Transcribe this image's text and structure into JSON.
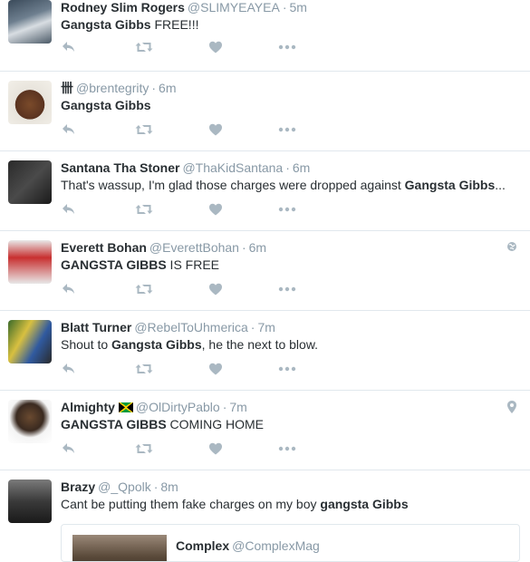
{
  "tweets": [
    {
      "name": "Rodney Slim Rogers",
      "handle": "@SLIMYEAYEA",
      "time": "5m",
      "text": [
        {
          "t": "Gangsta Gibbs",
          "b": true
        },
        {
          "t": " FREE!!!",
          "b": false
        }
      ]
    },
    {
      "name": "卌",
      "handle": "@brentegrity",
      "time": "6m",
      "text": [
        {
          "t": "Gangsta Gibbs",
          "b": true
        }
      ]
    },
    {
      "name": "Santana Tha Stoner",
      "handle": "@ThaKidSantana",
      "time": "6m",
      "text": [
        {
          "t": "That's wassup, I'm glad those charges were dropped against ",
          "b": false
        },
        {
          "t": "Gangsta Gibbs",
          "b": true
        },
        {
          "t": "...",
          "b": false
        }
      ]
    },
    {
      "name": "Everett Bohan",
      "handle": "@EverettBohan",
      "time": "6m",
      "text": [
        {
          "t": "GANGSTA GIBBS",
          "b": true
        },
        {
          "t": " IS FREE",
          "b": false
        }
      ],
      "corner_icon": "globe-icon"
    },
    {
      "name": "Blatt Turner",
      "handle": "@RebelToUhmerica",
      "time": "7m",
      "text": [
        {
          "t": "Shout to ",
          "b": false
        },
        {
          "t": "Gangsta Gibbs",
          "b": true
        },
        {
          "t": ", he the next to blow.",
          "b": false
        }
      ]
    },
    {
      "name": "Almighty",
      "handle": "@OlDirtyPablo",
      "time": "7m",
      "text": [
        {
          "t": "GANGSTA GIBBS",
          "b": true
        },
        {
          "t": " COMING HOME",
          "b": false
        }
      ],
      "flag_icon": "jamaica-flag-icon",
      "corner_icon": "location-pin-icon"
    },
    {
      "name": "Brazy",
      "handle": "@_Qpolk",
      "time": "8m",
      "text": [
        {
          "t": "Cant be putting them fake charges on my boy ",
          "b": false
        },
        {
          "t": "gangsta Gibbs",
          "b": true
        }
      ],
      "quote": {
        "name": "Complex",
        "handle": "@ComplexMag"
      }
    }
  ],
  "action_icons": [
    "reply-icon",
    "retweet-icon",
    "like-icon",
    "more-icon"
  ],
  "colors": {
    "text": "#292f33",
    "muted": "#8899a6",
    "icon": "#aab8c2",
    "border": "#e1e8ed"
  }
}
